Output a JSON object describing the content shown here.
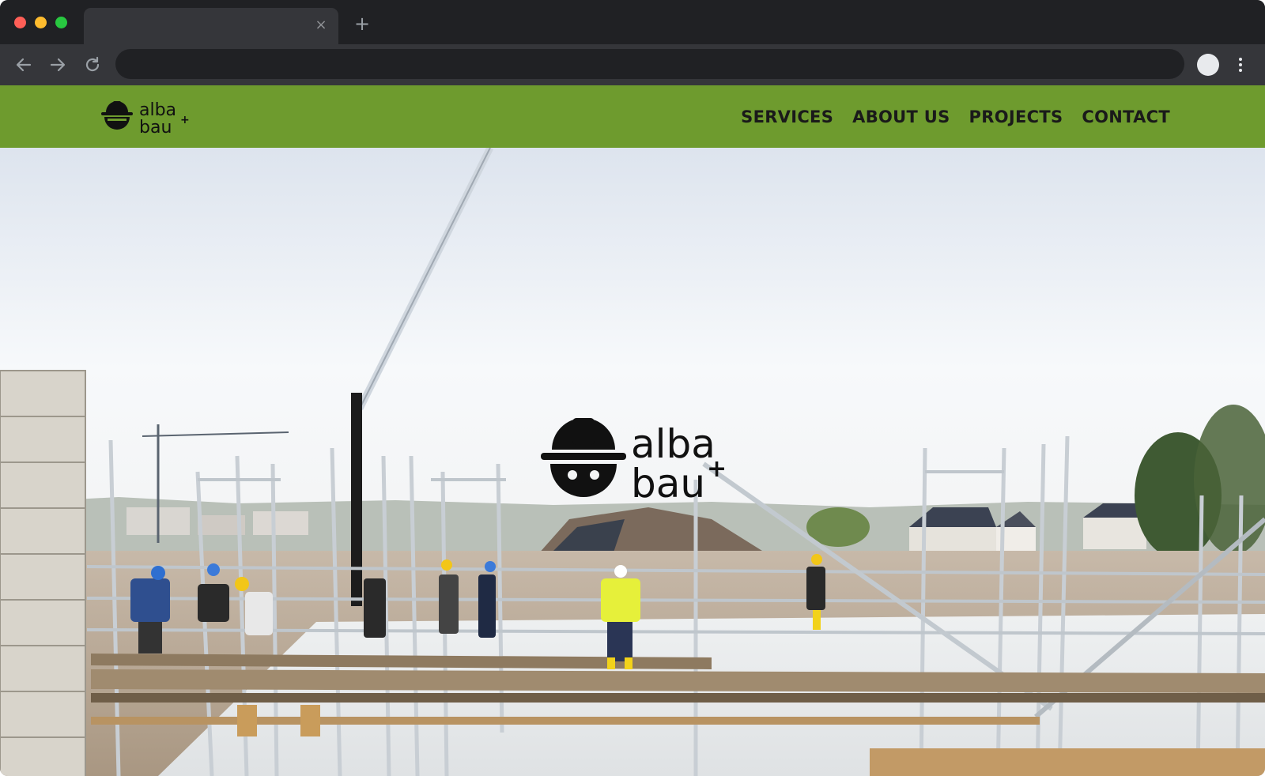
{
  "browser": {
    "tab_close_glyph": "×",
    "new_tab_glyph": "+",
    "icons": [
      "arrow-left-icon",
      "arrow-right-icon",
      "reload-icon",
      "profile-avatar",
      "kebab-menu-icon",
      "close-icon",
      "plus-icon"
    ]
  },
  "site": {
    "logo": {
      "line1": "alba",
      "line2": "bau",
      "superscript": "+"
    },
    "nav": [
      {
        "label": "SERVICES"
      },
      {
        "label": "ABOUT US"
      },
      {
        "label": "PROJECTS"
      },
      {
        "label": "CONTACT"
      }
    ],
    "hero": {
      "logo": {
        "line1": "alba",
        "line2": "bau",
        "superscript": "+"
      },
      "image_subject": "construction site with scaffolding and workers"
    }
  },
  "colors": {
    "header_green": "#6e9b2e",
    "nav_text": "#1a1a1a",
    "logo_black": "#111111",
    "chrome_dark": "#202124",
    "chrome_mid": "#35363a"
  }
}
